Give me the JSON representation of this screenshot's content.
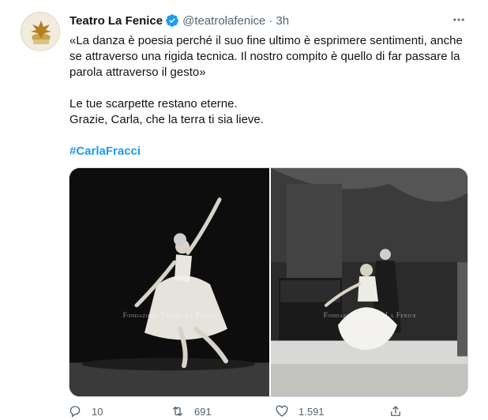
{
  "tweet": {
    "display_name": "Teatro La Fenice",
    "handle": "@teatrolafenice",
    "separator": "·",
    "time": "3h",
    "text_lines": [
      "«La danza è poesia perché il suo fine ultimo è esprimere sentimenti, anche",
      "se attraverso una rigida tecnica. Il nostro compito è quello di far passare la",
      "parola attraverso il gesto»"
    ],
    "text_lines_2": [
      "Le tue scarpette restano eterne.",
      "Grazie, Carla, che la terra ti sia lieve."
    ],
    "hashtag": "#CarlaFracci",
    "media": {
      "photo1_watermark": "Fondazione Teatro La Fenice",
      "photo2_watermark": "Fondazione Teatro La Fenice"
    },
    "actions": {
      "replies": "10",
      "retweets": "691",
      "likes": "1.591"
    }
  },
  "colors": {
    "accent": "#1d9bf0",
    "secondary_text": "#536471",
    "border": "#cfd9de"
  },
  "icons": [
    "avatar-logo",
    "verified-badge-icon",
    "more-icon",
    "reply-icon",
    "retweet-icon",
    "like-icon",
    "share-icon"
  ]
}
